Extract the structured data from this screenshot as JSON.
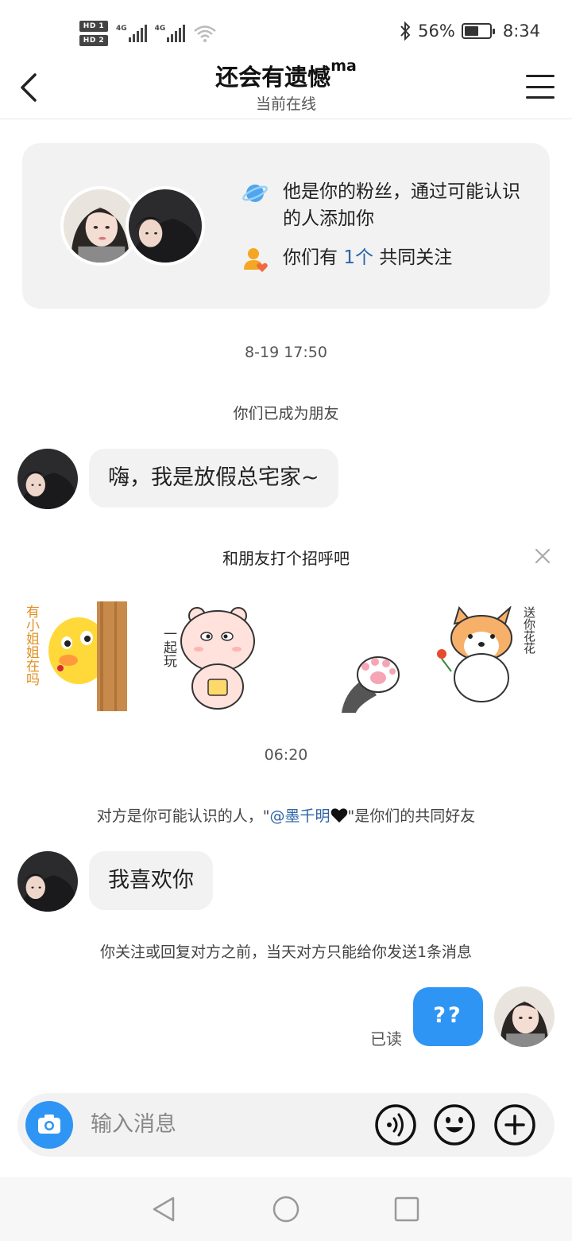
{
  "status_bar": {
    "hd1": "HD 1",
    "hd2": "HD 2",
    "net1": "4G",
    "net2": "4G",
    "battery_percent": "56%",
    "battery_level": 0.56,
    "time": "8:34"
  },
  "header": {
    "title": "还会有遗憾",
    "title_suffix": "ma",
    "subtitle": "当前在线"
  },
  "info_card": {
    "fan_text": "他是你的粉丝，通过可能认识的人添加你",
    "mutual_prefix": "你们有 ",
    "mutual_count": "1个",
    "mutual_suffix": " 共同关注"
  },
  "chat": {
    "timestamp_1": "8-19 17:50",
    "system_friends": "你们已成为朋友",
    "message_1": "嗨，我是放假总宅家~",
    "greet_title": "和朋友打个招呼吧",
    "stickers": [
      {
        "icon": "chick-peek-sticker",
        "caption": "有小姐姐在吗"
      },
      {
        "icon": "bear-sticker",
        "caption": "一起玩"
      },
      {
        "icon": "cat-paw-sticker",
        "caption": ""
      },
      {
        "icon": "corgi-flower-sticker",
        "caption": "送你花花"
      }
    ],
    "timestamp_2": "06:20",
    "system_mutual_prefix": "对方是你可能认识的人，\"",
    "system_mutual_name": "@墨千明",
    "system_mutual_suffix": "\"是你们的共同好友",
    "message_2": "我喜欢你",
    "system_limit": "你关注或回复对方之前，当天对方只能给你发送1条消息",
    "read_label": "已读",
    "message_out": "??"
  },
  "input_bar": {
    "placeholder": "输入消息"
  },
  "colors": {
    "accent": "#2f95f4",
    "link": "#2d63a8",
    "bubble_in": "#f2f2f2",
    "card_bg": "#f2f2f2"
  }
}
